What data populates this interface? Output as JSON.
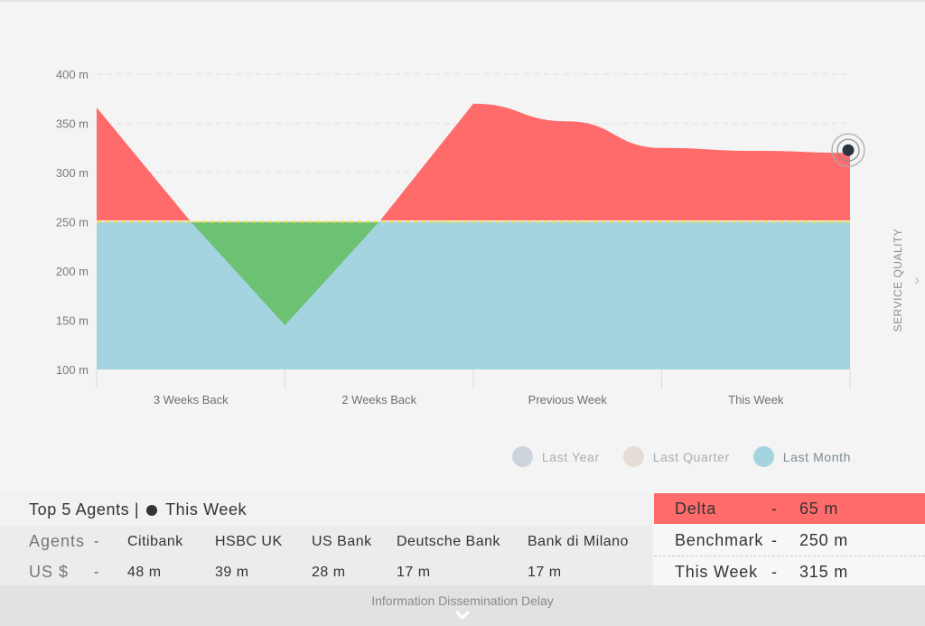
{
  "chart_data": {
    "type": "area",
    "categories": [
      "3 Weeks Back",
      "2 Weeks Back",
      "Previous Week",
      "This Week"
    ],
    "y_ticks": [
      "100 m",
      "150 m",
      "200 m",
      "250 m",
      "300 m",
      "350 m",
      "400 m"
    ],
    "ylim": [
      100,
      400
    ],
    "grid": true,
    "benchmark": 250,
    "series": [
      {
        "name": "Last Month",
        "values": [
          250,
          250,
          250,
          250,
          250,
          250,
          250,
          250,
          250
        ]
      }
    ],
    "this_week_curve": {
      "x": [
        0,
        0.5,
        1,
        1.5,
        2,
        2.5,
        3,
        3.5,
        4
      ],
      "values": [
        366,
        250,
        145,
        250,
        370,
        352,
        325,
        322,
        320
      ]
    },
    "side_label": "SERVICE QUALITY",
    "legend_position": "bottom-right",
    "legend": [
      {
        "label": "Last Year",
        "color": "#cdd3db",
        "text_color": "#a9adb3"
      },
      {
        "label": "Last Quarter",
        "color": "#e5ddd5",
        "text_color": "#a9adb3"
      },
      {
        "label": "Last Month",
        "color": "#a3d4df",
        "text_color": "#7a8a90"
      }
    ],
    "colors": {
      "above": "#ff6b6b",
      "below": "#6cc173",
      "base": "#a3d4df",
      "benchmark_line": "#f3e34a"
    }
  },
  "agents_panel": {
    "title": "Top 5 Agents |",
    "title_series": "This Week",
    "row_agents_label": "Agents",
    "row_us_label": "US $",
    "dash": "-",
    "agents": [
      "Citibank",
      "HSBC UK",
      "US Bank",
      "Deutsche Bank",
      "Bank di Milano"
    ],
    "values": [
      "48 m",
      "39 m",
      "28 m",
      "17 m",
      "17 m"
    ]
  },
  "summary": {
    "dash": "-",
    "delta_label": "Delta",
    "delta_value": "65 m",
    "benchmark_label": "Benchmark",
    "benchmark_value": "250 m",
    "thisweek_label": "This Week",
    "thisweek_value": "315 m"
  },
  "footer": {
    "label": "Information Dissemination  Delay"
  }
}
